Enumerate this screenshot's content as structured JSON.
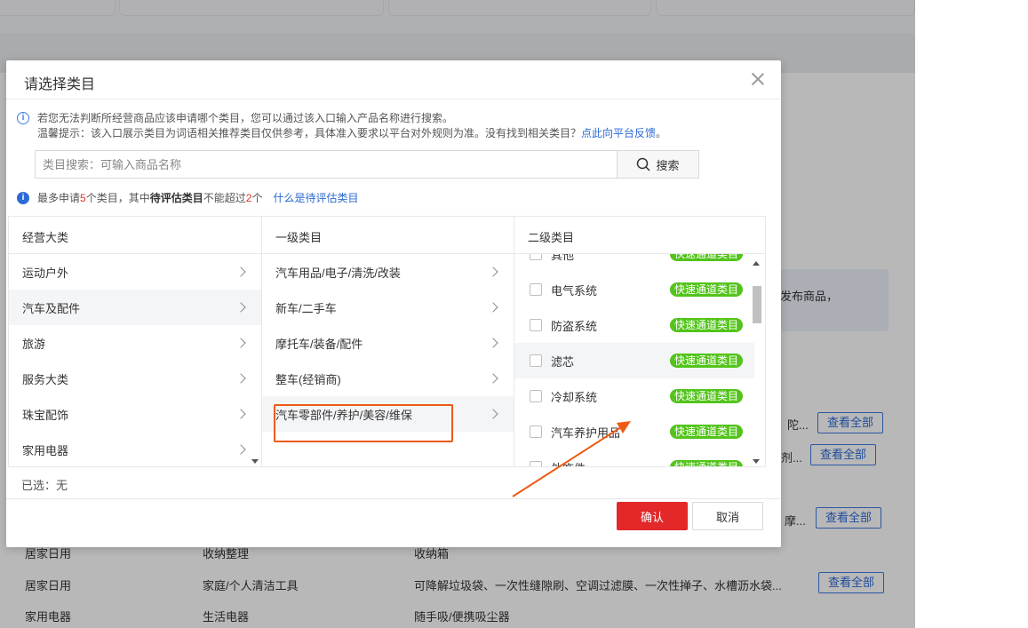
{
  "modal": {
    "title": "请选择类目",
    "tip_line1": "若您无法判断所经营商品应该申请哪个类目，您可以通过该入口输入产品名称进行搜索。",
    "tip_line2": "温馨提示：该入口展示类目为词语相关推荐类目仅供参考，具体准入要求以平台对外规则为准。没有找到相关类目？",
    "tip_link": "点此向平台反馈",
    "tip_end": "。",
    "search_placeholder": "类目搜索：可输入商品名称",
    "search_button": "搜索",
    "limit": {
      "prefix": "最多申请",
      "max_count": "5",
      "mid": "个类目，其中",
      "pending_label": "待评估类目",
      "mid2": "不能超过",
      "pending_count": "2",
      "suffix": "个",
      "link": "什么是待评估类目"
    },
    "columns": {
      "col1_header": "经营大类",
      "col2_header": "一级类目",
      "col3_header": "二级类目"
    },
    "col1_items": [
      "运动户外",
      "汽车及配件",
      "旅游",
      "服务大类",
      "珠宝配饰",
      "家用电器"
    ],
    "col2_items": [
      "汽车用品/电子/清洗/改装",
      "新车/二手车",
      "摩托车/装备/配件",
      "整车(经销商)",
      "汽车零部件/养护/美容/维保"
    ],
    "col3_items": [
      "其他",
      "电气系统",
      "防盗系统",
      "滤芯",
      "冷却系统",
      "汽车养护用品",
      "外饰件"
    ],
    "fast_tag": "快速通道类目",
    "selected_label": "已选：无",
    "confirm": "确认",
    "cancel": "取消"
  },
  "background": {
    "notice_text": "发布商品，",
    "rows": [
      {
        "desc": "陀...",
        "btn": "查看全部"
      },
      {
        "desc": "剂...",
        "btn": "查看全部"
      },
      {
        "desc": "摩...",
        "btn": "查看全部"
      },
      {
        "c1": "居家日用",
        "c2": "收纳整理",
        "c3": "收纳箱"
      },
      {
        "c1": "居家日用",
        "c2": "家庭/个人清洁工具",
        "c3": "可降解垃圾袋、一次性缝隙刷、空调过滤膜、一次性掸子、水槽沥水袋...",
        "btn": "查看全部"
      },
      {
        "c1": "家用电器",
        "c2": "生活电器",
        "c3": "随手吸/便携吸尘器"
      }
    ]
  },
  "colors": {
    "accent": "#2c6ad6",
    "confirm_red": "#e3282a",
    "fast_tag_green": "#52c41a",
    "highlight_orange": "#ee5a14"
  }
}
